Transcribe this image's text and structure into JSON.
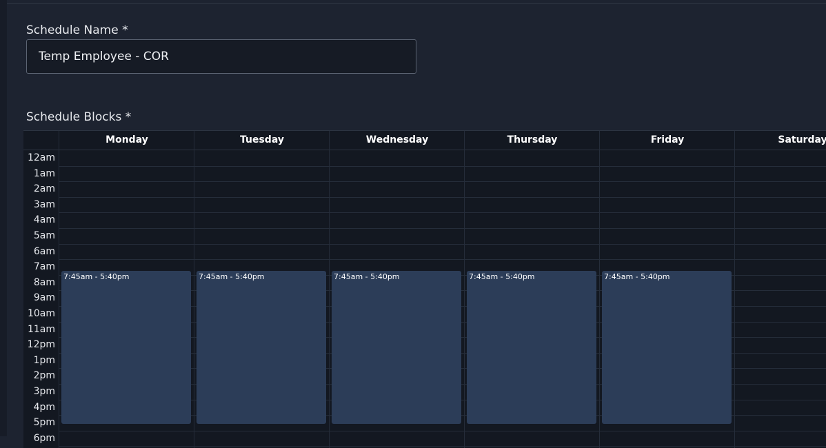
{
  "form": {
    "name_label": "Schedule Name *",
    "name_value": "Temp Employee - COR",
    "blocks_label": "Schedule Blocks *"
  },
  "calendar": {
    "days": [
      "Monday",
      "Tuesday",
      "Wednesday",
      "Thursday",
      "Friday",
      "Saturday"
    ],
    "hours": [
      "12am",
      "1am",
      "2am",
      "3am",
      "4am",
      "5am",
      "6am",
      "7am",
      "8am",
      "9am",
      "10am",
      "11am",
      "12pm",
      "1pm",
      "2pm",
      "3pm",
      "4pm",
      "5pm",
      "6pm"
    ],
    "blocks": [
      {
        "day": "Monday",
        "start": "7:45am",
        "end": "5:40pm",
        "label": "7:45am - 5:40pm"
      },
      {
        "day": "Tuesday",
        "start": "7:45am",
        "end": "5:40pm",
        "label": "7:45am - 5:40pm"
      },
      {
        "day": "Wednesday",
        "start": "7:45am",
        "end": "5:40pm",
        "label": "7:45am - 5:40pm"
      },
      {
        "day": "Thursday",
        "start": "7:45am",
        "end": "5:40pm",
        "label": "7:45am - 5:40pm"
      },
      {
        "day": "Friday",
        "start": "7:45am",
        "end": "5:40pm",
        "label": "7:45am - 5:40pm"
      }
    ]
  },
  "colors": {
    "page_bg": "#1d2330",
    "calendar_bg": "#131821",
    "block_bg": "#2c3d58"
  }
}
